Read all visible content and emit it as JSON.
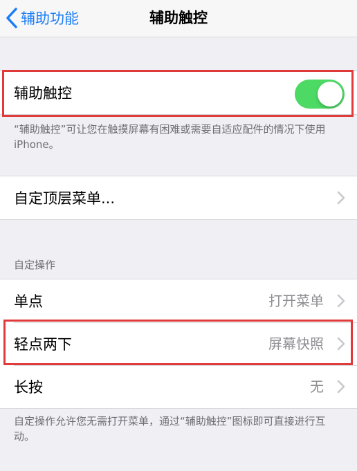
{
  "nav": {
    "back_label": "辅助功能",
    "title": "辅助触控"
  },
  "assistive_touch": {
    "label": "辅助触控",
    "enabled": true,
    "footnote": "“辅助触控”可让您在触摸屏幕有困难或需要自适应配件的情况下使用 iPhone。"
  },
  "customize": {
    "label": "自定顶层菜单..."
  },
  "custom_actions": {
    "header": "自定操作",
    "rows": [
      {
        "label": "单点",
        "value": "打开菜单"
      },
      {
        "label": "轻点两下",
        "value": "屏幕快照"
      },
      {
        "label": "长按",
        "value": "无"
      }
    ],
    "footnote": "自定操作允许您无需打开菜单，通过“辅助触控”图标即可直接进行互动。"
  },
  "colors": {
    "accent": "#1a7cf5",
    "toggle_on": "#4cd964",
    "highlight": "#e03a3a",
    "background": "#efeff4"
  }
}
